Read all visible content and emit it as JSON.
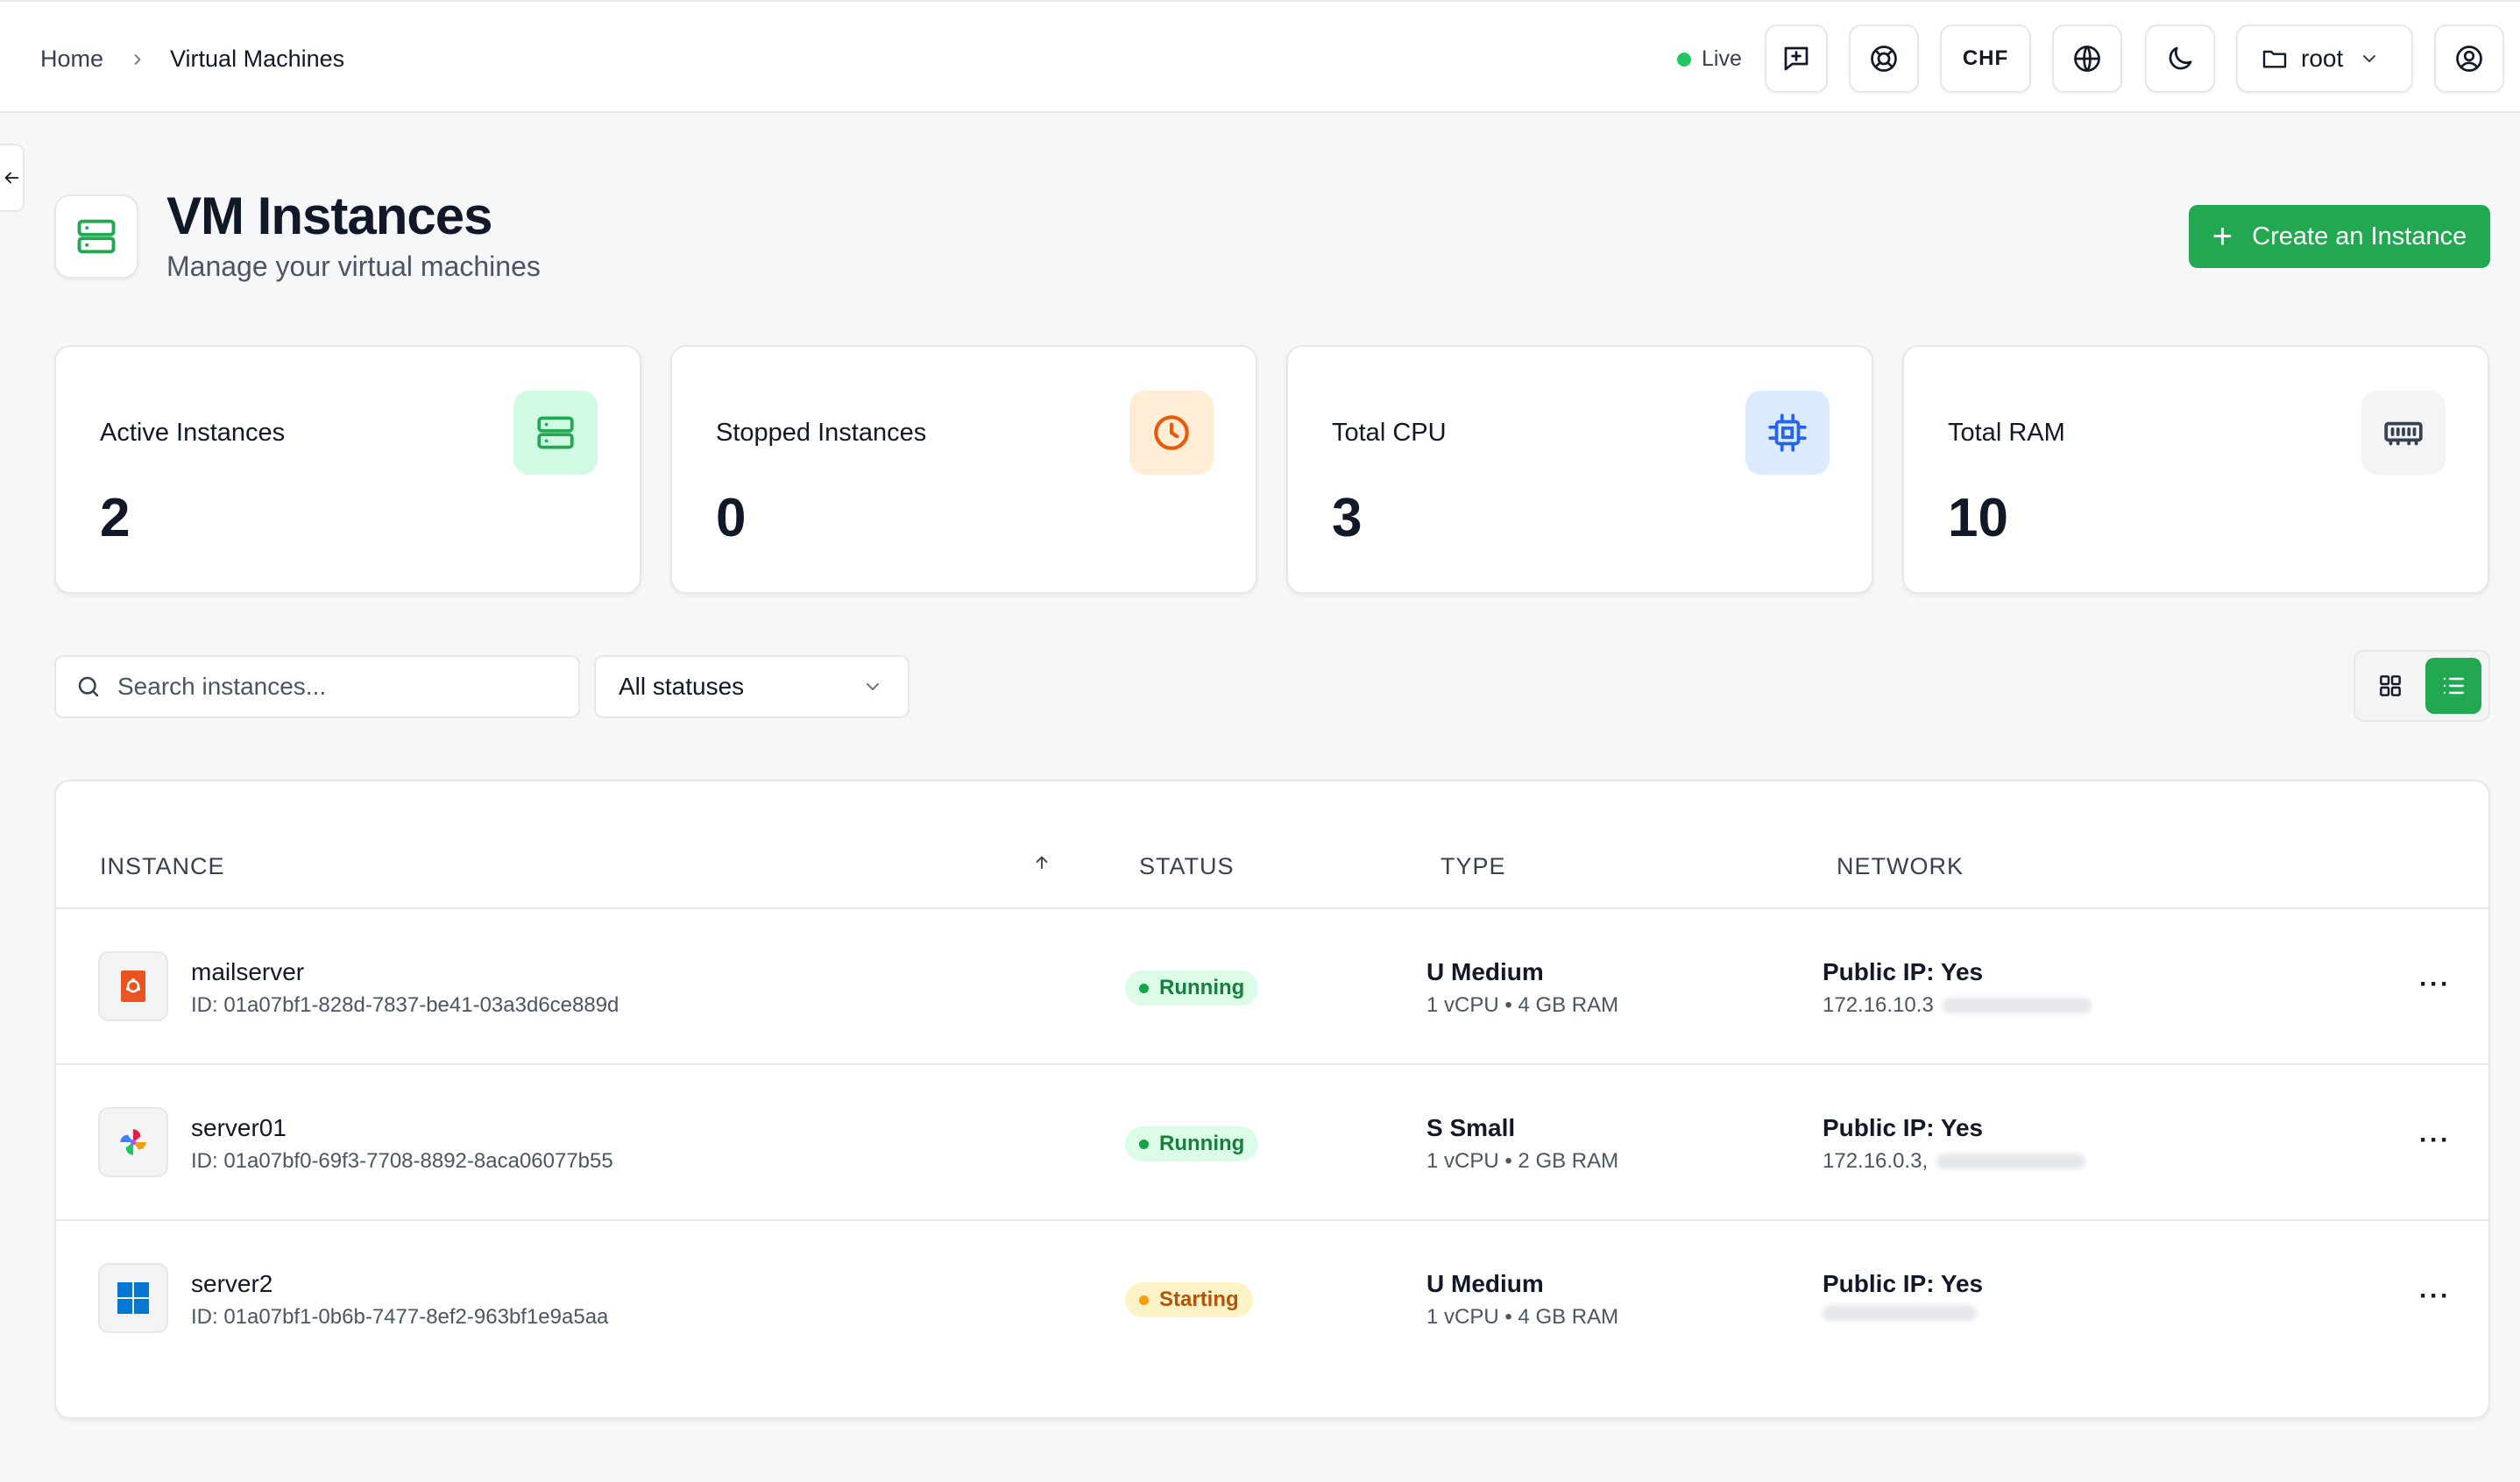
{
  "breadcrumb": {
    "home": "Home",
    "current": "Virtual Machines"
  },
  "header": {
    "live_label": "Live",
    "currency": "CHF",
    "folder": "root",
    "live_color": "#22c55e"
  },
  "page": {
    "title": "VM Instances",
    "subtitle": "Manage your virtual machines",
    "create_label": "Create an Instance",
    "accent_color": "#22a851"
  },
  "stats": [
    {
      "label": "Active Instances",
      "value": "2",
      "icon": "server-icon",
      "color": "#22a851"
    },
    {
      "label": "Stopped Instances",
      "value": "0",
      "icon": "clock-icon",
      "color": "#ea580c"
    },
    {
      "label": "Total CPU",
      "value": "3",
      "icon": "cpu-icon",
      "color": "#2563eb"
    },
    {
      "label": "Total RAM",
      "value": "10",
      "icon": "memory-icon",
      "color": "#374151"
    }
  ],
  "filters": {
    "search_placeholder": "Search instances...",
    "status_selected": "All statuses"
  },
  "table": {
    "columns": [
      "INSTANCE",
      "STATUS",
      "TYPE",
      "NETWORK"
    ],
    "rows": [
      {
        "name": "mailserver",
        "id": "ID: 01a07bf1-828d-7837-be41-03a3d6ce889d",
        "os_icon": "ubuntu-icon",
        "status": "Running",
        "type": "U Medium",
        "spec": "1 vCPU • 4 GB RAM",
        "network_title": "Public IP: Yes",
        "ip": "172.16.10.3"
      },
      {
        "name": "server01",
        "id": "ID: 01a07bf0-69f3-7708-8892-8aca06077b55",
        "os_icon": "pinwheel-os-icon",
        "status": "Running",
        "type": "S Small",
        "spec": "1 vCPU • 2 GB RAM",
        "network_title": "Public IP: Yes",
        "ip": "172.16.0.3,"
      },
      {
        "name": "server2",
        "id": "ID: 01a07bf1-0b6b-7477-8ef2-963bf1e9a5aa",
        "os_icon": "windows-icon",
        "status": "Starting",
        "type": "U Medium",
        "spec": "1 vCPU • 4 GB RAM",
        "network_title": "Public IP: Yes",
        "ip": ""
      }
    ]
  }
}
